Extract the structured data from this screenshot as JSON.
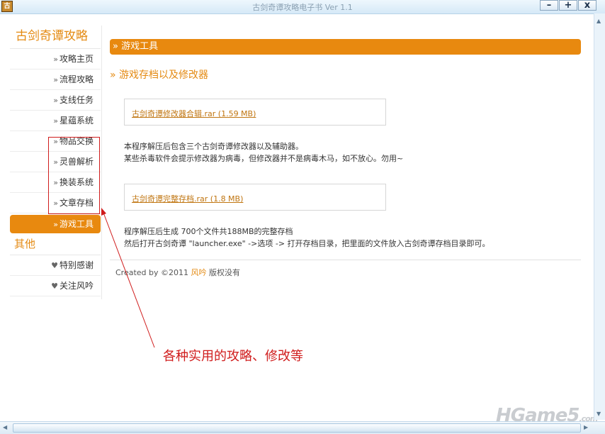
{
  "window": {
    "title": "古剑奇谭攻略电子书 Ver 1.1",
    "minimize": "–",
    "maximize": "+",
    "close": "x"
  },
  "sidebar": {
    "title": "古剑奇谭攻略",
    "items": [
      {
        "arrow": "»",
        "label": "攻略主页"
      },
      {
        "arrow": "»",
        "label": "流程攻略"
      },
      {
        "arrow": "»",
        "label": "支线任务"
      },
      {
        "arrow": "»",
        "label": "星蕴系统"
      },
      {
        "arrow": "»",
        "label": "物品交换"
      },
      {
        "arrow": "»",
        "label": "灵兽解析"
      },
      {
        "arrow": "»",
        "label": "换装系统"
      },
      {
        "arrow": "»",
        "label": "文章存档"
      },
      {
        "arrow": "»",
        "label": "游戏工具"
      }
    ],
    "other_title": "其他",
    "other_items": [
      {
        "arrow": "♥",
        "label": "特别感谢"
      },
      {
        "arrow": "♥",
        "label": "关注风吟"
      }
    ]
  },
  "main": {
    "section_title": "» 游戏工具",
    "subheading": "» 游戏存档以及修改器",
    "downloads": [
      {
        "link": "古剑奇谭修改器合辑.rar (1.59 MB)"
      },
      {
        "link": "古剑奇谭完整存档.rar (1.8 MB)"
      }
    ],
    "desc1": [
      "本程序解压后包含三个古剑奇谭修改器以及辅助器。",
      "某些杀毒软件会提示修改器为病毒，但修改器并不是病毒木马，如不放心。勿用~"
    ],
    "desc2": [
      "程序解压后生成 700个文件共188MB的完整存档",
      "然后打开古剑奇谭 \"launcher.exe\" ->选项 -> 打开存档目录，把里面的文件放入古剑奇谭存档目录即可。"
    ],
    "footer": {
      "prefix": "Created by ©2011",
      "brand": "风吟",
      "suffix": "版权没有"
    }
  },
  "annotation": {
    "text": "各种实用的攻略、修改等",
    "color": "#d01c1c"
  },
  "watermark": {
    "text": "HGame5",
    "suffix": ".com"
  },
  "colors": {
    "accent": "#e8890f",
    "link": "#c07510"
  }
}
